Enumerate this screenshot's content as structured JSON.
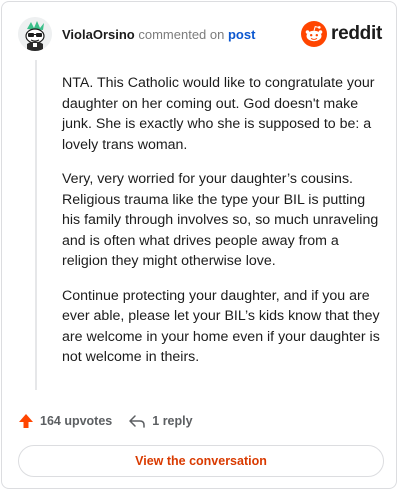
{
  "header": {
    "username": "ViolaOrsino",
    "verb": "commented on",
    "post_link": "post",
    "brand": "reddit"
  },
  "comment": {
    "paragraphs": [
      "NTA. This Catholic would like to congratulate your daughter on her coming out. God doesn't make junk. She is exactly who she is supposed to be: a lovely trans woman.",
      "Very, very worried for your daughter’s cousins. Religious trauma like the type your BIL is putting his family through involves so, so much unraveling and is often what drives people away from a religion they might otherwise love.",
      "Continue protecting your daughter, and if you are ever able, please let your BIL’s kids know that they are welcome in your home even if your daughter is not welcome in theirs."
    ]
  },
  "actions": {
    "upvotes": "164 upvotes",
    "replies": "1 reply"
  },
  "cta": {
    "label": "View the conversation"
  },
  "colors": {
    "reddit_orange": "#ff4500",
    "link_blue": "#0b57d0",
    "cta_text": "#d93a00"
  },
  "icons": {
    "avatar": "snoo-avatar",
    "upvote": "upvote-arrow-icon",
    "reply": "reply-arrow-icon",
    "logo": "reddit-snoo-icon"
  }
}
